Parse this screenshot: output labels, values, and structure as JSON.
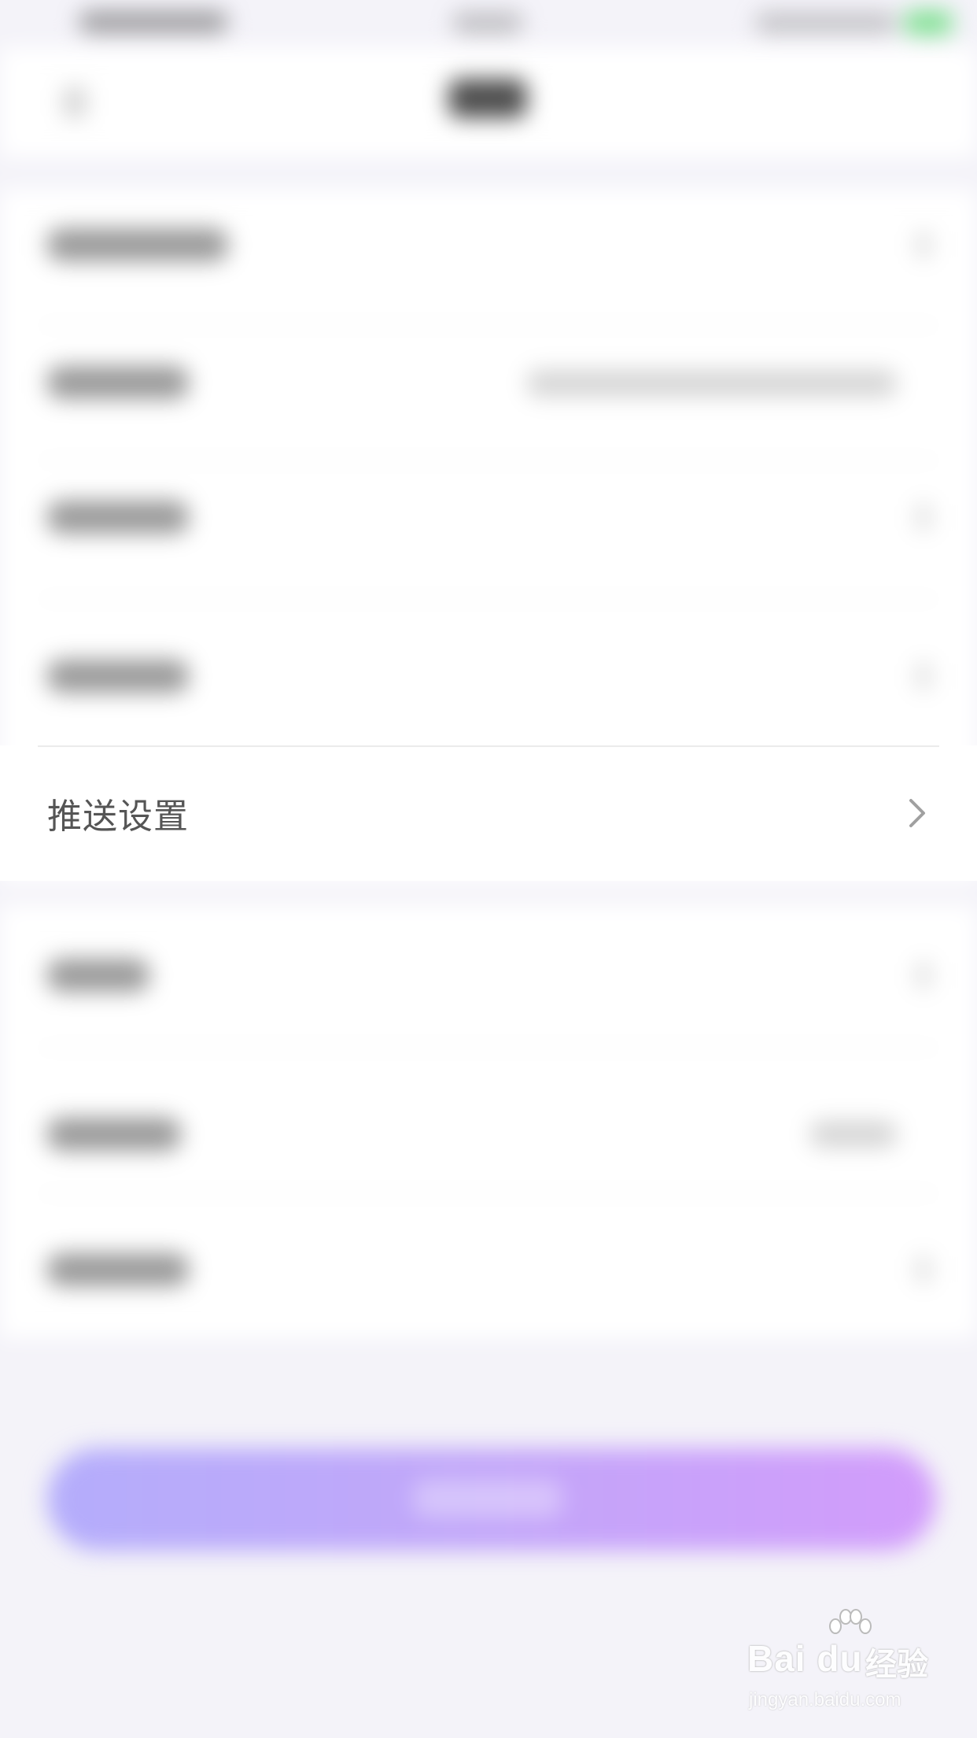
{
  "settings": {
    "push_row": {
      "label": "推送设置",
      "chevron_icon": "chevron-right-icon"
    }
  },
  "watermark": {
    "brand": "Bai du",
    "brand_cn": "经验",
    "url": "jingyan.baidu.com",
    "paw_icon": "baidu-paw-icon"
  },
  "colors": {
    "background": "#f4f3f9",
    "card": "#ffffff",
    "label_text": "#555555",
    "chevron": "#a0a0a0",
    "button_gradient_start": "#b4adfb",
    "button_gradient_end": "#d29cfb",
    "battery": "#4cd964"
  }
}
